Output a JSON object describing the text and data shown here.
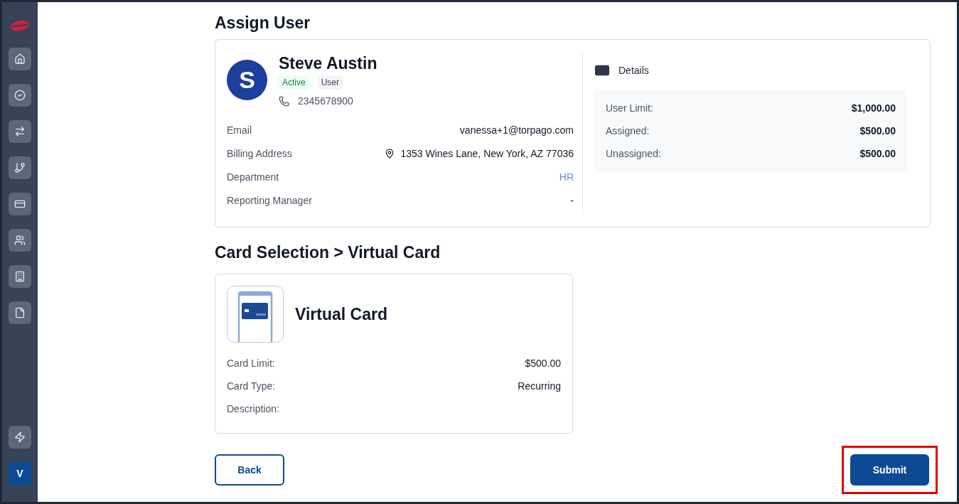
{
  "sidebar": {
    "items": [
      {
        "kind": "home"
      },
      {
        "kind": "tasks"
      },
      {
        "kind": "transfers"
      },
      {
        "kind": "flows"
      },
      {
        "kind": "cards"
      },
      {
        "kind": "people"
      },
      {
        "kind": "company"
      },
      {
        "kind": "documents"
      }
    ],
    "bottom": [
      {
        "kind": "bolt"
      }
    ],
    "avatar": "V"
  },
  "title": "Assign User",
  "user": {
    "initial": "S",
    "name": "Steve Austin",
    "badges": [
      {
        "label": "Active",
        "kind": "status"
      },
      {
        "label": "User",
        "kind": "role"
      }
    ],
    "phone": "2345678900",
    "fields": [
      {
        "label": "Email",
        "value": "vanessa+1@torpago.com",
        "kind": "text"
      },
      {
        "label": "Billing Address",
        "value": "1353 Wines Lane, New York, AZ 77036",
        "kind": "address"
      },
      {
        "label": "Department",
        "value": "HR",
        "kind": "link"
      },
      {
        "label": "Reporting Manager",
        "value": "-",
        "kind": "text"
      }
    ]
  },
  "details": {
    "title": "Details",
    "rows": [
      {
        "label": "User Limit:",
        "value": "$1,000.00"
      },
      {
        "label": "Assigned:",
        "value": "$500.00"
      },
      {
        "label": "Unassigned:",
        "value": "$500.00"
      }
    ]
  },
  "card_section": {
    "title": "Card Selection > Virtual Card",
    "card_name": "Virtual Card",
    "rows": [
      {
        "label": "Card Limit:",
        "value": "$500.00"
      },
      {
        "label": "Card Type:",
        "value": "Recurring"
      },
      {
        "label": "Description:",
        "value": ""
      }
    ]
  },
  "buttons": {
    "back": "Back",
    "submit": "Submit",
    "submit_highlighted": true
  }
}
